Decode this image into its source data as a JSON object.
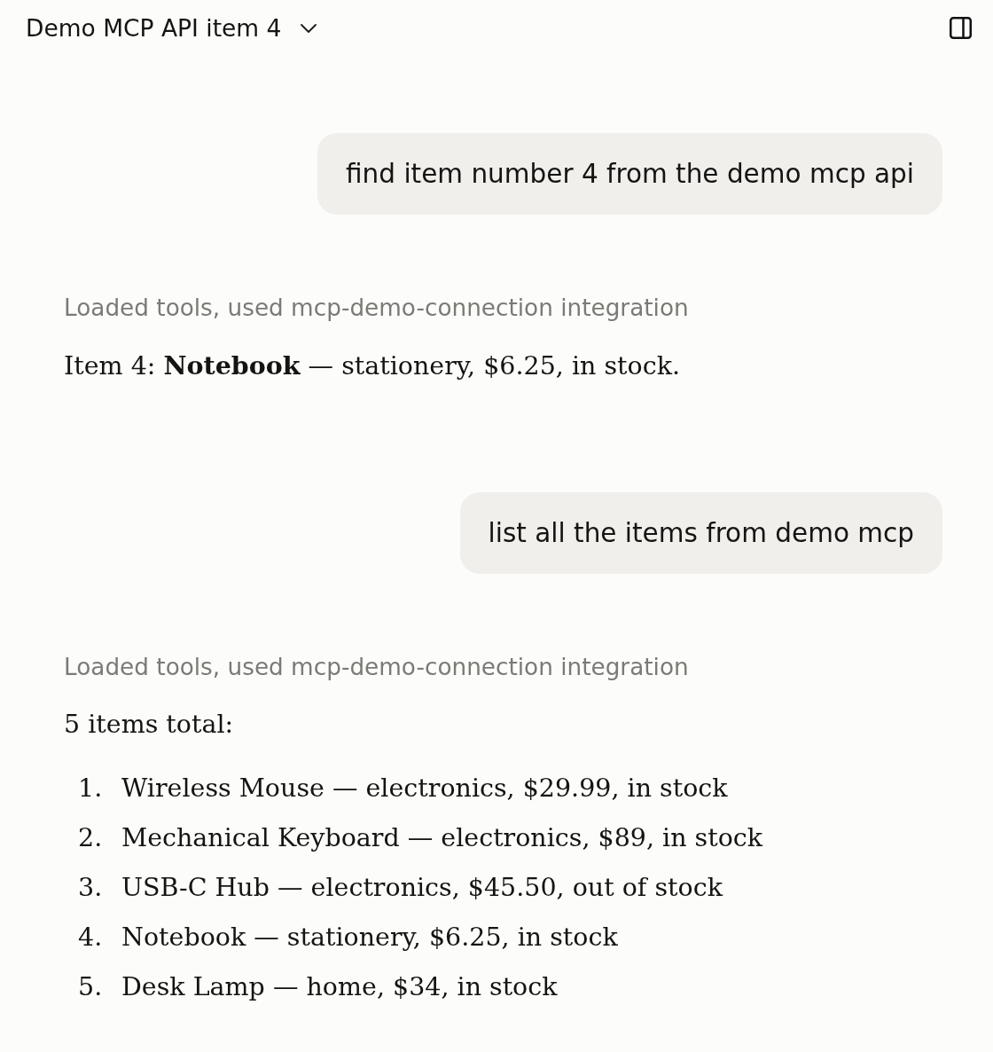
{
  "header": {
    "title": "Demo MCP API item 4"
  },
  "messages": [
    {
      "kind": "user",
      "text": "find item number 4 from the demo mcp api"
    },
    {
      "kind": "assistant",
      "tool_note": "Loaded tools, used mcp-demo-connection integration",
      "paragraphs": [
        "Item 4: **Notebook** — stationery, $6.25, in stock."
      ]
    },
    {
      "kind": "user",
      "text": "list all the items from demo mcp"
    },
    {
      "kind": "assistant",
      "tool_note": "Loaded tools, used mcp-demo-connection integration",
      "paragraphs": [
        "5 items total:"
      ],
      "list": [
        {
          "number": "1.",
          "text": "Wireless Mouse — electronics, $29.99, in stock"
        },
        {
          "number": "2.",
          "text": "Mechanical Keyboard — electronics, $89, in stock"
        },
        {
          "number": "3.",
          "text": "USB-C Hub — electronics, $45.50, out of stock"
        },
        {
          "number": "4.",
          "text": "Notebook — stationery, $6.25, in stock"
        },
        {
          "number": "5.",
          "text": "Desk Lamp — home, $34, in stock"
        }
      ]
    }
  ]
}
